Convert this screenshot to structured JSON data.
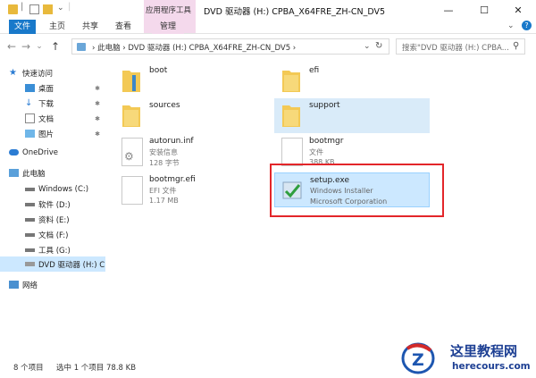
{
  "window": {
    "title": "DVD 驱动器 (H:) CPBA_X64FRE_ZH-CN_DV5",
    "context_tab": "应用程序工具",
    "controls": {
      "minimize": "—",
      "maximize": "☐",
      "close": "✕"
    }
  },
  "ribbon": {
    "tabs": [
      {
        "label": "文件"
      },
      {
        "label": "主页"
      },
      {
        "label": "共享"
      },
      {
        "label": "查看"
      },
      {
        "label": "管理"
      }
    ],
    "expand_glyph": "⌄",
    "help_glyph": "?"
  },
  "address": {
    "path": "› 此电脑 › DVD 驱动器 (H:) CPBA_X64FRE_ZH-CN_DV5 ›",
    "search_placeholder": "搜索\"DVD 驱动器 (H:) CPBA...",
    "back": "←",
    "forward": "→",
    "up": "↑",
    "recent": "⌄",
    "refresh": "↻",
    "search_icon": "⚲"
  },
  "nav": {
    "items": [
      {
        "label": "快速访问",
        "icon": "star-icon",
        "pinned": false,
        "selected": false
      },
      {
        "label": "桌面",
        "icon": "desktop-icon",
        "pinned": true,
        "selected": false
      },
      {
        "label": "下载",
        "icon": "download-icon",
        "pinned": true,
        "selected": false
      },
      {
        "label": "文档",
        "icon": "document-icon",
        "pinned": true,
        "selected": false
      },
      {
        "label": "图片",
        "icon": "picture-icon",
        "pinned": true,
        "selected": false
      },
      {
        "label": "OneDrive",
        "icon": "cloud-icon",
        "pinned": false,
        "selected": false
      },
      {
        "label": "此电脑",
        "icon": "computer-icon",
        "pinned": false,
        "selected": false
      },
      {
        "label": "Windows (C:)",
        "icon": "drive-icon",
        "pinned": false,
        "selected": false
      },
      {
        "label": "软件 (D:)",
        "icon": "drive-icon",
        "pinned": false,
        "selected": false
      },
      {
        "label": "资料 (E:)",
        "icon": "drive-icon",
        "pinned": false,
        "selected": false
      },
      {
        "label": "文档 (F:)",
        "icon": "drive-icon",
        "pinned": false,
        "selected": false
      },
      {
        "label": "工具 (G:)",
        "icon": "drive-icon",
        "pinned": false,
        "selected": false
      },
      {
        "label": "DVD 驱动器 (H:) C",
        "icon": "dvd-icon",
        "pinned": false,
        "selected": true
      },
      {
        "label": "网络",
        "icon": "network-icon",
        "pinned": false,
        "selected": false
      }
    ],
    "pin_glyph": "📌"
  },
  "files": [
    {
      "name": "boot",
      "meta1": "",
      "meta2": "",
      "type": "folder",
      "state": ""
    },
    {
      "name": "efi",
      "meta1": "",
      "meta2": "",
      "type": "folder",
      "state": ""
    },
    {
      "name": "sources",
      "meta1": "",
      "meta2": "",
      "type": "folder",
      "state": ""
    },
    {
      "name": "support",
      "meta1": "",
      "meta2": "",
      "type": "folder",
      "state": "hover"
    },
    {
      "name": "autorun.inf",
      "meta1": "安装信息",
      "meta2": "128 字节",
      "type": "inf",
      "state": ""
    },
    {
      "name": "bootmgr",
      "meta1": "文件",
      "meta2": "388 KB",
      "type": "file",
      "state": ""
    },
    {
      "name": "bootmgr.efi",
      "meta1": "EFI 文件",
      "meta2": "1.17 MB",
      "type": "file",
      "state": ""
    },
    {
      "name": "setup.exe",
      "meta1": "Windows Installer",
      "meta2": "Microsoft Corporation",
      "type": "exe",
      "state": "selected"
    }
  ],
  "status": {
    "count": "8 个项目",
    "selection": "选中 1 个项目 78.8 KB"
  },
  "watermark": {
    "site_name": "这里教程网",
    "site_url": "herecours.com"
  },
  "colors": {
    "accent": "#1979ca",
    "selection": "#cce8ff",
    "highlight_box": "#e3262a",
    "folder": "#f3c955"
  }
}
